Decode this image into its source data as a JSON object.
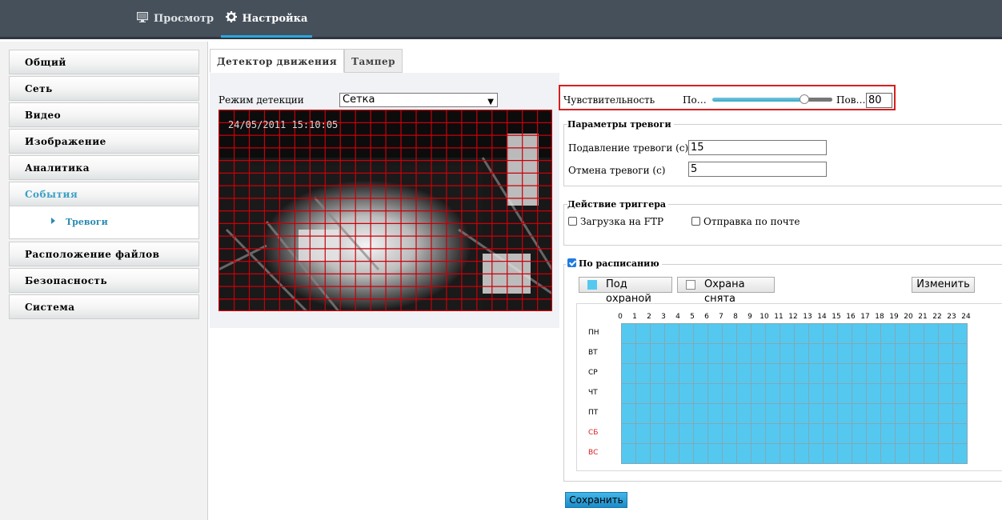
{
  "topnav": {
    "preview_label": "Просмотр",
    "settings_label": "Настройка"
  },
  "sidebar": {
    "items": [
      {
        "label": "Общий"
      },
      {
        "label": "Сеть"
      },
      {
        "label": "Видео"
      },
      {
        "label": "Изображение"
      },
      {
        "label": "Аналитика"
      },
      {
        "label": "События"
      },
      {
        "label": "Расположение файлов"
      },
      {
        "label": "Безопасность"
      },
      {
        "label": "Система"
      }
    ],
    "sub_item": "Тревоги"
  },
  "tabs": [
    {
      "label": "Детектор движения"
    },
    {
      "label": "Тампер"
    }
  ],
  "detection": {
    "mode_label": "Режим детекции",
    "mode_value": "Сетка",
    "timestamp": "24/05/2011 15:10:05"
  },
  "sensitivity": {
    "label": "Чувствительность",
    "low_label": "По…",
    "high_label": "Пов…",
    "value": "80",
    "level_fraction": 0.8
  },
  "alarm_params": {
    "legend": "Параметры тревоги",
    "suppress_label": "Подавление тревоги (с)",
    "suppress_value": "15",
    "cancel_label": "Отмена тревоги (с)",
    "cancel_value": "5"
  },
  "trigger": {
    "legend": "Действие триггера",
    "ftp_label": "Загрузка на FTP",
    "mail_label": "Отправка по почте"
  },
  "schedule": {
    "legend": "По расписанию",
    "armed_label": "Под охраной",
    "disarmed_label": "Охрана снята",
    "edit_label": "Изменить",
    "hours": [
      "0",
      "1",
      "2",
      "3",
      "4",
      "5",
      "6",
      "7",
      "8",
      "9",
      "10",
      "11",
      "12",
      "13",
      "14",
      "15",
      "16",
      "17",
      "18",
      "19",
      "20",
      "21",
      "22",
      "23",
      "24"
    ],
    "days": [
      "ПН",
      "ВТ",
      "СР",
      "ЧТ",
      "ПТ",
      "СБ",
      "ВС"
    ],
    "armed_color": "#55c8ef",
    "weekend_color": "#d42020"
  },
  "save_label": "Сохранить",
  "colors": {
    "accent": "#2aa7df",
    "grid_line": "#c8000a",
    "topbar": "#46505a"
  }
}
